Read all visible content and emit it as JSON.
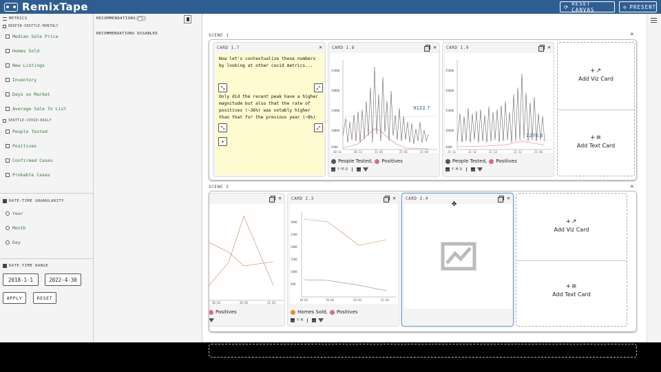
{
  "app": {
    "title": "RemixTape"
  },
  "topbar": {
    "reset_label": "RESET CANVAS",
    "present_label": "PRESENT"
  },
  "sidebar": {
    "metrics_label": "METRICS",
    "source1": "REDFIN-SEATTLE-MONTHLY",
    "source1_items": [
      "Median Sale Price",
      "Homes Sold",
      "New Listings",
      "Inventory",
      "Days on Market",
      "Average Sale To List"
    ],
    "source2": "SEATTLE-COVID-DAILY",
    "source2_items": [
      "People Tested",
      "Positives",
      "Confirmed Cases",
      "Probable Cases"
    ],
    "granularity_label": "DATE-TIME GRANULARITY",
    "granularity_options": [
      "Year",
      "Month",
      "Day"
    ],
    "range_label": "DATE-TIME RANGE",
    "range_start": "2018-1-1",
    "range_end": "2022-4-30",
    "apply_label": "APPLY",
    "reset_label": "RESET"
  },
  "recommendations": {
    "title": "RECOMMENDATIONS",
    "status": "RECOMMENDATIONS DISABLED"
  },
  "scene1": {
    "label": "SCENE 1",
    "card17": {
      "title": "CARD 1.7",
      "text1": "Now let's contextualize these numbers by looking at other covid metrics...",
      "text2": "Only did the recent peak have a higher magnitude but also that the rate of positives (~36%) was notably higher than that for the previous year (~8%)"
    },
    "card18": {
      "title": "CARD 1.8",
      "annotation": "9122.7",
      "legend_a": "People Tested,",
      "legend_b": "Positives",
      "granularity": "Y-M-D",
      "yticks": [
        "25000",
        "20000",
        "15000",
        "10000",
        "5000"
      ],
      "xticks": [
        "20-11",
        "20-11",
        "21-01",
        "21-01",
        "21-03"
      ]
    },
    "card19": {
      "title": "CARD 1.9",
      "annotation": "1270.3",
      "legend_a": "People Tested,",
      "legend_b": "Positives",
      "granularity": "Y-M-D",
      "yticks": [
        "25000",
        "20000",
        "15000",
        "10000",
        "5000"
      ],
      "xticks": [
        "21-11",
        "21-12",
        "21-12",
        "21-12",
        "21-03"
      ]
    },
    "add_viz": "Add Viz Card",
    "add_text": "Add Text Card"
  },
  "scene2": {
    "label": "SCENE 2",
    "card22": {
      "legend_b": "Positives",
      "xticks": [
        "20-03",
        "20-03",
        "21-03"
      ]
    },
    "card23": {
      "title": "CARD 2.3",
      "legend_a": "Homes Sold,",
      "legend_b": "Positives",
      "granularity": "Y-M",
      "yticks": [
        "3000",
        "2500",
        "2000",
        "1500",
        "1000",
        "500"
      ],
      "xticks": [
        "18-03",
        "19-03",
        "20-03",
        "21-03"
      ]
    },
    "card24": {
      "title": "CARD 2.4"
    },
    "add_viz": "Add Viz Card",
    "add_text": "Add Text Card"
  },
  "colors": {
    "accent": "#2e5e91",
    "grey_series": "#555555",
    "pink_series": "#d56b91",
    "orange_series": "#e58a2e",
    "note_bg": "#fdfbcf"
  }
}
